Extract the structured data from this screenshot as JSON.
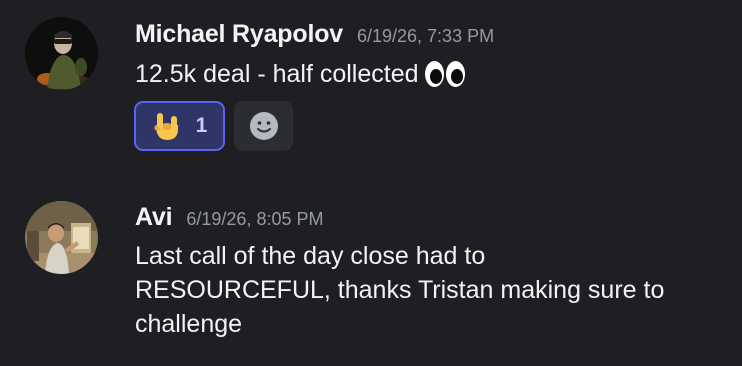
{
  "messages": [
    {
      "username": "Michael Ryapolov",
      "timestamp": "6/19/26, 7:33 PM",
      "content": "12.5k deal - half collected",
      "content_emoji": "eyes-emoji",
      "reactions": [
        {
          "emoji": "sign-of-the-horns-emoji",
          "count": "1",
          "active": true
        }
      ],
      "add_reaction_icon": "smiley-icon"
    },
    {
      "username": "Avi",
      "timestamp": "6/19/26, 8:05 PM",
      "content_lines": [
        "Last call of the day close had to",
        "RESOURCEFUL, thanks Tristan making sure to",
        "challenge"
      ]
    }
  ],
  "colors": {
    "background": "#1f1f23",
    "username": "#f2f3f5",
    "timestamp": "#949ba4",
    "reaction_active_bg": "#2f3567",
    "reaction_active_border": "#5865f2",
    "reaction_add_bg": "#2b2d31"
  }
}
